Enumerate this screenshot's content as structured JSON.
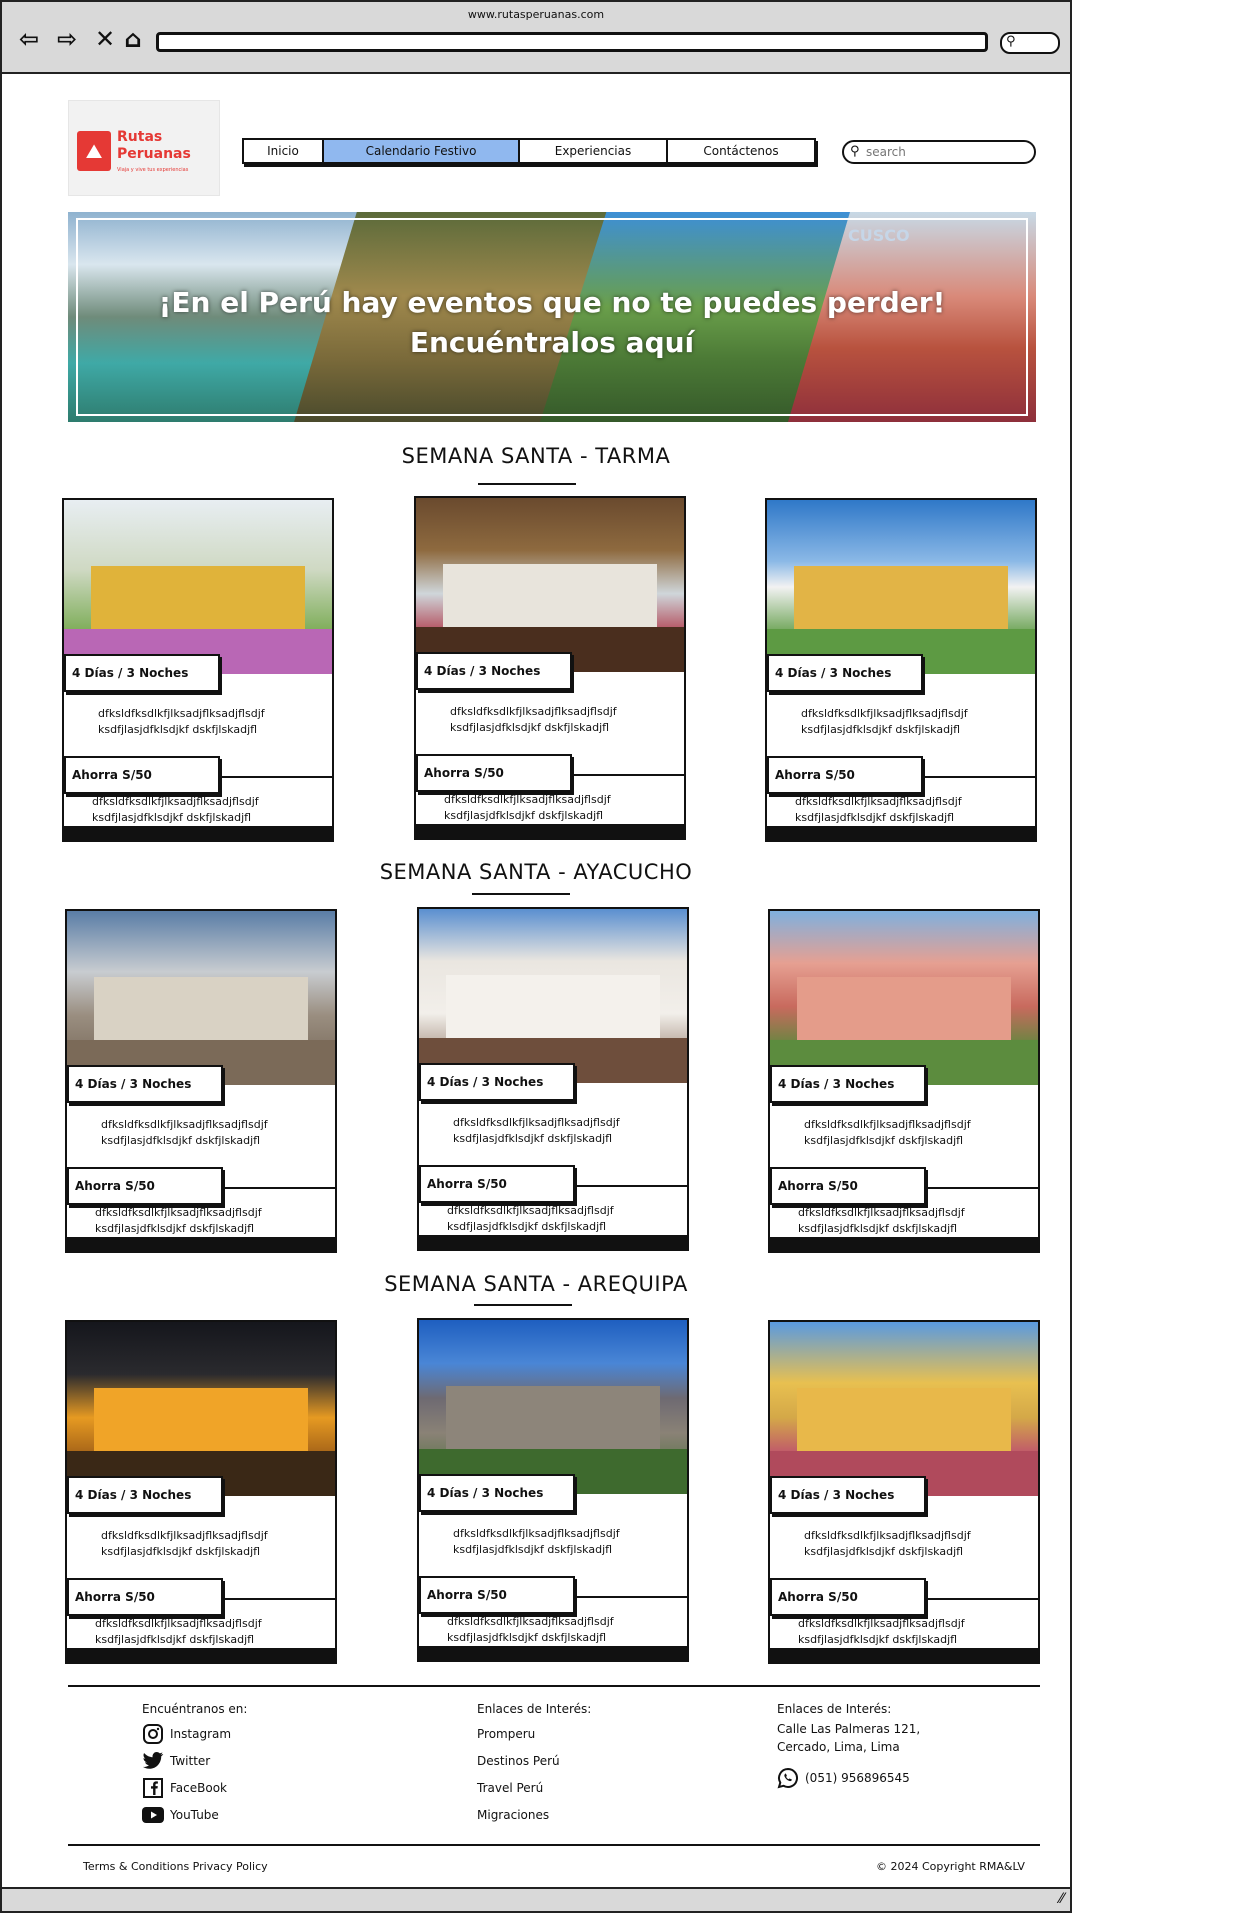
{
  "browser": {
    "url": "www.rutasperuanas.com"
  },
  "brand": {
    "name_line1": "Rutas",
    "name_line2": "Peruanas",
    "tagline": "Viaja y vive tus experiencias"
  },
  "nav": {
    "items": [
      "Inicio",
      "Calendario Festivo",
      "Experiencias",
      "Contáctenos"
    ],
    "active": "Calendario Festivo"
  },
  "search": {
    "placeholder": "search"
  },
  "hero": {
    "line1": "¡En el Perú hay eventos que no te puedes perder!",
    "line2": "Encuéntralos aquí",
    "watermark": "CUSCO"
  },
  "sections": [
    {
      "title": "SEMANA SANTA - TARMA",
      "cards": [
        {
          "duration": "4 Días / 3 Noches",
          "desc": "dfksldfksdlkfjlksadjflksadjflsdjf ksdfjlasjdfklsdjkf dskfjlskadjfl",
          "price": "Ahorra S/50",
          "desc2": "dfksldfksdlkfjlksadjflksadjflsdjf ksdfjlasjdfklsdjkf dskfjlskadjfl"
        },
        {
          "duration": "4 Días / 3 Noches",
          "desc": "dfksldfksdlkfjlksadjflksadjflsdjf ksdfjlasjdfklsdjkf dskfjlskadjfl",
          "price": "Ahorra S/50",
          "desc2": "dfksldfksdlkfjlksadjflksadjflsdjf ksdfjlasjdfklsdjkf dskfjlskadjfl"
        },
        {
          "duration": "4 Días / 3 Noches",
          "desc": "dfksldfksdlkfjlksadjflksadjflsdjf ksdfjlasjdfklsdjkf dskfjlskadjfl",
          "price": "Ahorra S/50",
          "desc2": "dfksldfksdlkfjlksadjflksadjflsdjf ksdfjlasjdfklsdjkf dskfjlskadjfl"
        }
      ]
    },
    {
      "title": "SEMANA SANTA - AYACUCHO",
      "cards": [
        {
          "duration": "4 Días / 3 Noches",
          "desc": "dfksldfksdlkfjlksadjflksadjflsdjf ksdfjlasjdfklsdjkf dskfjlskadjfl",
          "price": "Ahorra S/50",
          "desc2": "dfksldfksdlkfjlksadjflksadjflsdjf ksdfjlasjdfklsdjkf dskfjlskadjfl"
        },
        {
          "duration": "4 Días / 3 Noches",
          "desc": "dfksldfksdlkfjlksadjflksadjflsdjf ksdfjlasjdfklsdjkf dskfjlskadjfl",
          "price": "Ahorra S/50",
          "desc2": "dfksldfksdlkfjlksadjflksadjflsdjf ksdfjlasjdfklsdjkf dskfjlskadjfl"
        },
        {
          "duration": "4 Días / 3 Noches",
          "desc": "dfksldfksdlkfjlksadjflksadjflsdjf ksdfjlasjdfklsdjkf dskfjlskadjfl",
          "price": "Ahorra S/50",
          "desc2": "dfksldfksdlkfjlksadjflksadjflsdjf ksdfjlasjdfklsdjkf dskfjlskadjfl"
        }
      ]
    },
    {
      "title": "SEMANA SANTA - AREQUIPA",
      "cards": [
        {
          "duration": "4 Días / 3 Noches",
          "desc": "dfksldfksdlkfjlksadjflksadjflsdjf ksdfjlasjdfklsdjkf dskfjlskadjfl",
          "price": "Ahorra S/50",
          "desc2": "dfksldfksdlkfjlksadjflksadjflsdjf ksdfjlasjdfklsdjkf dskfjlskadjfl"
        },
        {
          "duration": "4 Días / 3 Noches",
          "desc": "dfksldfksdlkfjlksadjflksadjflsdjf ksdfjlasjdfklsdjkf dskfjlskadjfl",
          "price": "Ahorra S/50",
          "desc2": "dfksldfksdlkfjlksadjflksadjflsdjf ksdfjlasjdfklsdjkf dskfjlskadjfl"
        },
        {
          "duration": "4 Días / 3 Noches",
          "desc": "dfksldfksdlkfjlksadjflksadjflsdjf ksdfjlasjdfklsdjkf dskfjlskadjfl",
          "price": "Ahorra S/50",
          "desc2": "dfksldfksdlkfjlksadjflksadjflsdjf ksdfjlasjdfklsdjkf dskfjlskadjfl"
        }
      ]
    }
  ],
  "footer": {
    "social": {
      "heading": "Encuéntranos en:",
      "items": [
        {
          "label": "Instagram",
          "icon": "instagram-icon"
        },
        {
          "label": "Twitter",
          "icon": "twitter-icon"
        },
        {
          "label": "FaceBook",
          "icon": "facebook-icon"
        },
        {
          "label": "YouTube",
          "icon": "youtube-icon"
        }
      ]
    },
    "links": {
      "heading": "Enlaces de Interés:",
      "items": [
        "Promperu",
        "Destinos Perú",
        "Travel Perú",
        "Migraciones"
      ]
    },
    "contact": {
      "heading": "Enlaces de Interés:",
      "address_line1": "Calle Las Palmeras 121,",
      "address_line2": "Cercado, Lima, Lima",
      "phone": "(051) 956896545"
    },
    "legal": "Terms & Conditions Privacy Policy",
    "copyright": "© 2024 Copyright RMA&LV"
  }
}
